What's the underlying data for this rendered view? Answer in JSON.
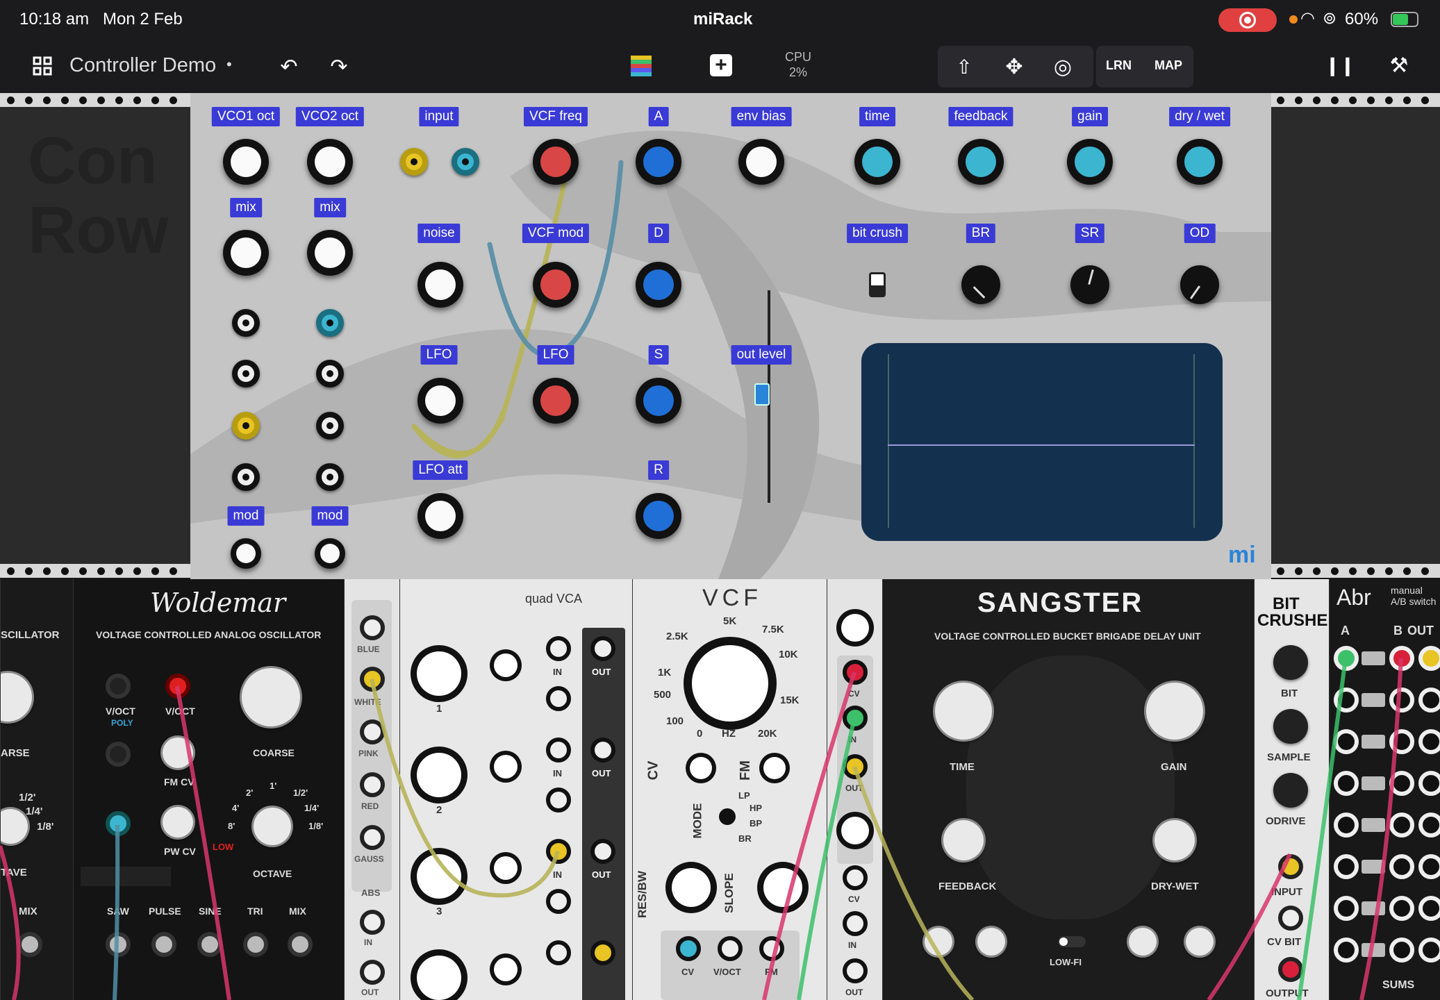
{
  "status_bar": {
    "time": "10:18 am",
    "date": "Mon 2 Feb",
    "app_name": "miRack",
    "battery": "60%"
  },
  "toolbar": {
    "patch_name": "Controller Demo",
    "modified_marker": "•",
    "cpu_label": "CPU",
    "cpu_value": "2%",
    "learn_label": "LRN",
    "map_label": "MAP"
  },
  "controller": {
    "labels": {
      "vco1_oct": "VCO1 oct",
      "vco2_oct": "VCO2 oct",
      "input": "input",
      "vcf_freq": "VCF freq",
      "a": "A",
      "env_bias": "env bias",
      "time": "time",
      "feedback": "feedback",
      "gain": "gain",
      "dry_wet": "dry / wet",
      "mix1": "mix",
      "mix2": "mix",
      "noise": "noise",
      "vcf_mod": "VCF mod",
      "d": "D",
      "bit_crush": "bit crush",
      "br": "BR",
      "sr": "SR",
      "od": "OD",
      "lfo1": "LFO",
      "lfo2": "LFO",
      "s": "S",
      "out_level": "out level",
      "lfo_att": "LFO att",
      "r": "R",
      "mod1": "mod",
      "mod2": "mod"
    },
    "brand": "mi",
    "bg_watermark_line1": "Con",
    "bg_watermark_line2": "Row"
  },
  "rack": {
    "woldemar": {
      "title": "Woldemar",
      "subtitle": "VOLTAGE CONTROLLED ANALOG OSCILLATOR",
      "left_title": "SCILLATOR",
      "voct1": "V/OCT",
      "poly": "POLY",
      "voct2": "V/OCT",
      "coarse": "COARSE",
      "fm_cv": "FM CV",
      "pw_cv": "PW CV",
      "octave": "OCTAVE",
      "low": "LOW",
      "saw": "SAW",
      "pulse": "PULSE",
      "sine": "SINE",
      "tri": "TRI",
      "mix": "MIX",
      "left_mix": "MIX",
      "left_arse": "ARSE",
      "left_ave": "TAVE",
      "frac_half": "1/2'",
      "frac_quarter": "1/4'",
      "frac_eighth": "1/8'",
      "oct_2": "2'",
      "oct_1": "1'",
      "oct_4": "4'",
      "oct_8": "8'"
    },
    "noise": {
      "blue": "BLUE",
      "white": "WHITE",
      "pink": "PINK",
      "red": "RED",
      "gauss": "GAUSS",
      "abs": "ABS",
      "in": "IN",
      "out": "OUT"
    },
    "quad_vca": {
      "title": "quad VCA",
      "in": "IN",
      "out": "OUT",
      "ch1": "1",
      "ch2": "2",
      "ch3": "3"
    },
    "vcf": {
      "title": "VCF",
      "hz": "HZ",
      "f_2_5k": "2.5K",
      "f_5k": "5K",
      "f_7_5k": "7.5K",
      "f_1k": "1K",
      "f_10k": "10K",
      "f_500": "500",
      "f_15k": "15K",
      "f_100": "100",
      "f_0": "0",
      "f_20k": "20K",
      "cv": "CV",
      "fm": "FM",
      "mode": "MODE",
      "lp": "LP",
      "hp": "HP",
      "bp": "BP",
      "br": "BR",
      "res_bw": "RES/BW",
      "slope": "SLOPE",
      "cv_jack": "CV",
      "voct": "V/OCT",
      "fm_jack": "FM"
    },
    "small": {
      "cv": "CV",
      "in": "IN",
      "out": "OUT"
    },
    "sangster": {
      "title": "SANGSTER",
      "subtitle": "VOLTAGE CONTROLLED BUCKET BRIGADE DELAY UNIT",
      "time": "TIME",
      "gain": "GAIN",
      "feedback": "FEEDBACK",
      "dry_wet": "DRY-WET",
      "low_fi": "LOW-FI"
    },
    "bitcrusher": {
      "title_1": "BIT",
      "title_2": "CRUSHER",
      "bit": "BIT",
      "sample": "SAMPLE",
      "odrive": "ODRIVE",
      "input": "INPUT",
      "cv_bit": "CV BIT",
      "output": "OUTPUT"
    },
    "abr": {
      "title": "Abr",
      "subtitle_1": "manual",
      "subtitle_2": "A/B switch",
      "a": "A",
      "b": "B",
      "out": "OUT",
      "sums": "SUMS"
    }
  },
  "colors": {
    "label_bg": "#3a3ad6",
    "knob_red": "#d84646",
    "knob_blue": "#1f6fd6",
    "knob_cyan": "#3cb5d0",
    "scope_bg": "#14304f",
    "record_red": "#e04040"
  }
}
